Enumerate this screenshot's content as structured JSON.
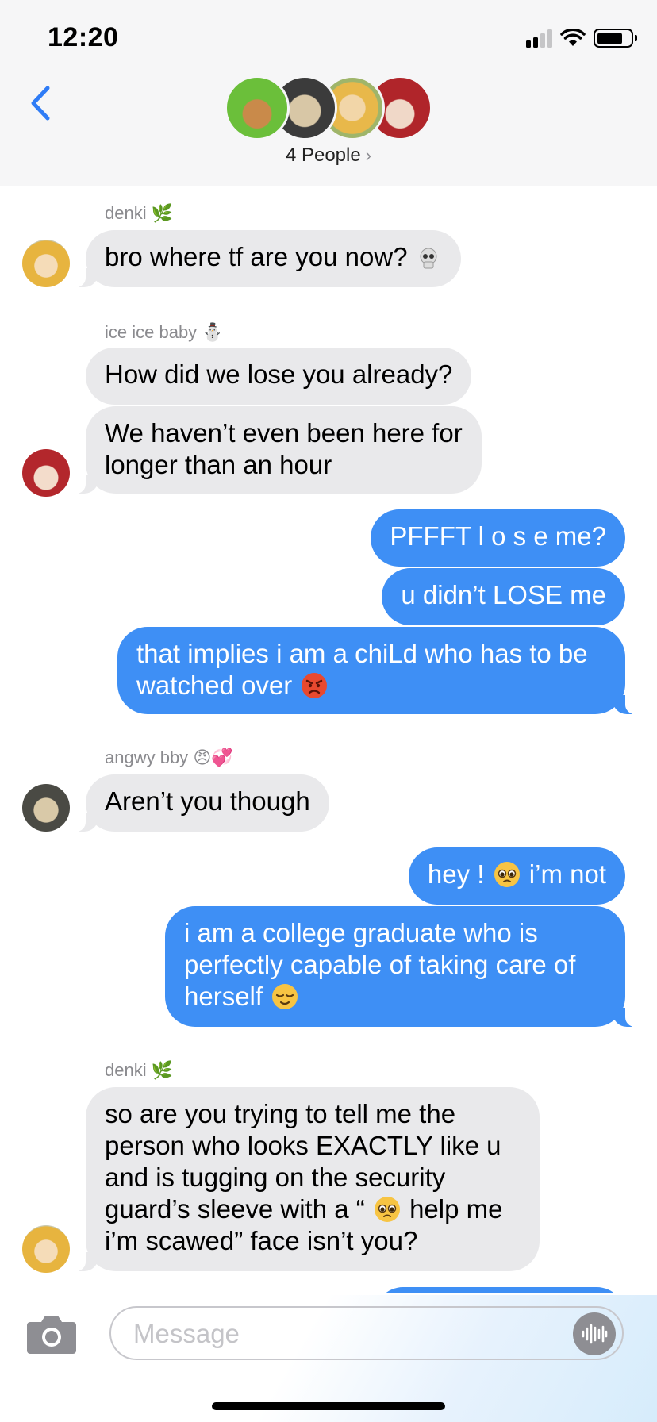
{
  "status_bar": {
    "time": "12:20"
  },
  "header": {
    "people_label": "4 People",
    "people_chevron": "›"
  },
  "messages": {
    "m1": {
      "sender": "denki",
      "sender_emoji": "🌿",
      "text": "bro where tf are you now?"
    },
    "m2": {
      "sender": "ice ice baby",
      "sender_emoji": "⛄",
      "text": "How did we lose you already?"
    },
    "m3": {
      "line1": "We haven’t even been here for",
      "line2": "longer than an hour"
    },
    "m4": {
      "text": "PFFFT l o s e me?"
    },
    "m5": {
      "text": "u didn’t LOSE me"
    },
    "m6": {
      "line1": "that implies i am a chiLd who has to be",
      "line2": "watched over"
    },
    "m7": {
      "sender": "angwy bby",
      "sender_emoji": "😠💞",
      "text": "Aren’t you though"
    },
    "m8": {
      "text_a": "hey !",
      "text_b": "i’m not"
    },
    "m9": {
      "line1": "i am a college graduate who is",
      "line2": "perfectly capable of taking care of",
      "line3": "herself"
    },
    "m10": {
      "sender": "denki",
      "sender_emoji": "🌿",
      "line1": "so are you trying to tell me the",
      "line2": "person who looks EXACTLY like u",
      "line3": "and is tugging on the security",
      "line4a": "guard’s sleeve with a “",
      "line4b": "help me",
      "line5": "i’m scawed” face isn’t you?"
    }
  },
  "input": {
    "placeholder": "Message"
  },
  "colors": {
    "outgoing": "#3e8ff5",
    "incoming": "#e9e9eb",
    "accent": "#2f7cf6"
  },
  "icons": {
    "back": "chevron-left-icon",
    "camera": "camera-icon",
    "voice": "waveform-icon",
    "signal": "cellular-signal-icon",
    "wifi": "wifi-icon",
    "battery": "battery-icon"
  }
}
